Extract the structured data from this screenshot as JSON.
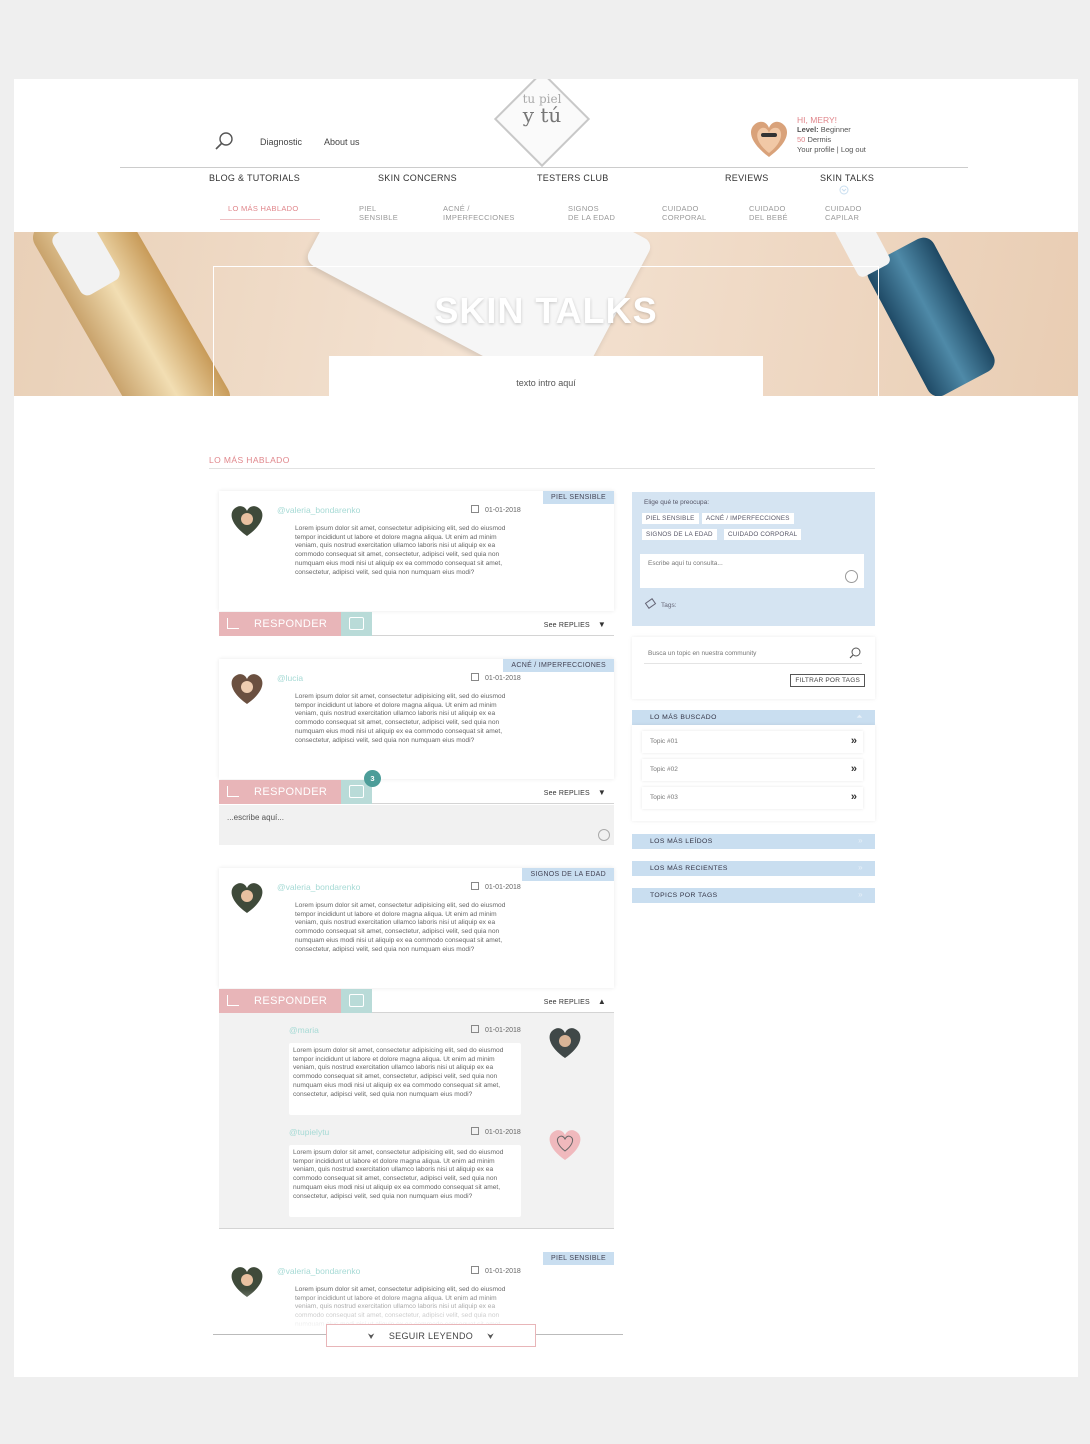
{
  "header": {
    "logo_line1": "tu piel",
    "logo_line2": "y tú",
    "links": [
      "Diagnostic",
      "About us"
    ],
    "user": {
      "greeting": "HI, MERY!",
      "level_label": "Level:",
      "level_value": "Beginner",
      "points_value": "50",
      "points_label": "Dermis",
      "profile_link": "Your profile",
      "separator": "|",
      "logout_link": "Log out"
    }
  },
  "nav": {
    "main": [
      "BLOG & TUTORIALS",
      "SKIN CONCERNS",
      "TESTERS CLUB",
      "REVIEWS",
      "SKIN TALKS"
    ],
    "sub": [
      {
        "line1": "LO MÁS HABLADO",
        "line2": ""
      },
      {
        "line1": "PIEL",
        "line2": "SENSIBLE"
      },
      {
        "line1": "ACNÉ /",
        "line2": "IMPERFECCIONES"
      },
      {
        "line1": "SIGNOS",
        "line2": "DE LA EDAD"
      },
      {
        "line1": "CUIDADO",
        "line2": "CORPORAL"
      },
      {
        "line1": "CUIDADO",
        "line2": "DEL BEBÉ"
      },
      {
        "line1": "CUIDADO",
        "line2": "CAPILAR"
      }
    ]
  },
  "hero": {
    "title": "SKIN TALKS",
    "intro": "texto intro aquí"
  },
  "section_title": "LO MÁS HABLADO",
  "lorem": "Lorem ipsum dolor sit amet, consectetur adipisicing elit, sed do eiusmod tempor incididunt ut labore et dolore magna aliqua. Ut enim ad minim veniam, quis nostrud exercitation ullamco laboris nisi ut aliquip ex ea commodo consequat sit amet, consectetur, adipisci velit, sed quia non numquam eius modi nisi ut aliquip ex ea commodo consequat sit amet, consectetur, adipisci velit, sed quia non numquam eius modi?",
  "posts": [
    {
      "user": "@valeria_bondarenko",
      "date": "01-01-2018",
      "tag": "PIEL SENSIBLE"
    },
    {
      "user": "@lucia",
      "date": "01-01-2018",
      "tag": "ACNÉ / IMPERFECCIONES",
      "likes": "3"
    },
    {
      "user": "@valeria_bondarenko",
      "date": "01-01-2018",
      "tag": "SIGNOS DE LA EDAD"
    },
    {
      "user": "@valeria_bondarenko",
      "date": "01-01-2018",
      "tag": "PIEL SENSIBLE"
    }
  ],
  "replies": [
    {
      "user": "@maria",
      "date": "01-01-2018"
    },
    {
      "user": "@tupielytu",
      "date": "01-01-2018"
    }
  ],
  "actions": {
    "respond": "RESPONDER",
    "see_replies": "See REPLIES",
    "reply_placeholder": "...escribe aquí...",
    "load_more": "SEGUIR LEYENDO"
  },
  "sidebar": {
    "ask_label": "Elige qué te preocupa:",
    "chips": [
      "PIEL SENSIBLE",
      "ACNÉ / IMPERFECCIONES",
      "SIGNOS DE LA EDAD",
      "CUIDADO CORPORAL"
    ],
    "ask_placeholder": "Escribe aquí tu consulta...",
    "tags_label": "Tags:",
    "search_placeholder": "Busca un topic en nuestra community",
    "filter_button": "FILTRAR POR TAGS",
    "most_searched": "LO MÁS BUSCADO",
    "topics": [
      "Topic #01",
      "Topic #02",
      "Topic #03"
    ],
    "links": [
      "LOS MÁS LEÍDOS",
      "LOS MÁS RECIENTES",
      "TOPICS POR TAGS"
    ]
  },
  "colors": {
    "accent_pink": "#e8b5b8",
    "accent_mint": "#b9dbd8",
    "accent_blue": "#c9def0",
    "username": "#a6dad5"
  }
}
